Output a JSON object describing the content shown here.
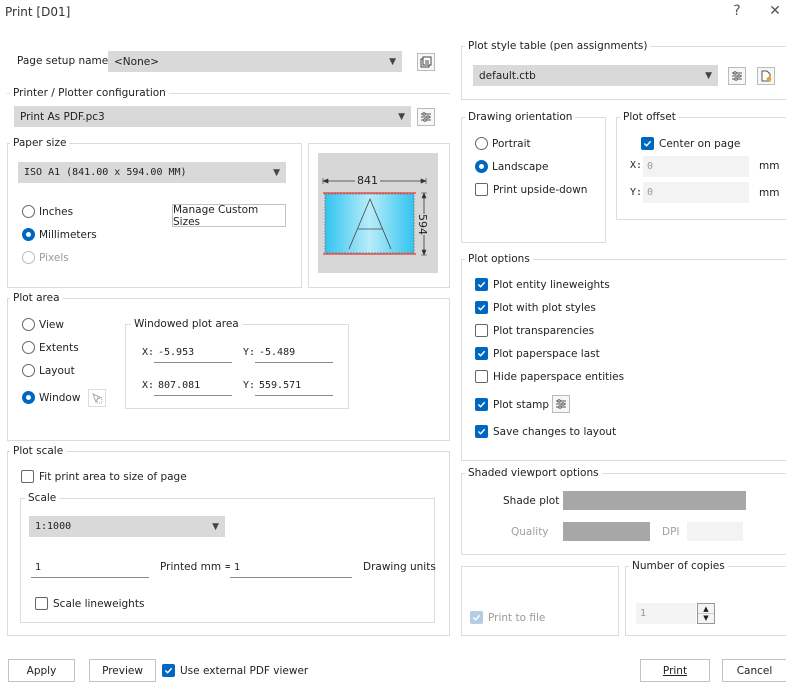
{
  "window": {
    "title": "Print [D01]",
    "help": "?",
    "close": "✕"
  },
  "page_setup": {
    "label": "Page setup name:",
    "value": "<None>"
  },
  "printer": {
    "group": "Printer / Plotter configuration",
    "value": "Print As PDF.pc3"
  },
  "paper_size": {
    "group": "Paper size",
    "value": "ISO A1 (841.00 x 594.00 MM)",
    "units": [
      "Inches",
      "Millimeters",
      "Pixels"
    ],
    "manage_button": "Manage Custom Sizes"
  },
  "preview": {
    "width": "841",
    "height": "594"
  },
  "plot_area": {
    "group": "Plot area",
    "options": [
      "View",
      "Extents",
      "Layout",
      "Window"
    ],
    "window_group": "Windowed plot area",
    "x1_label": "X:",
    "x1": "-5.953",
    "y1_label": "Y:",
    "y1": "-5.489",
    "x2_label": "X:",
    "x2": "807.081",
    "y2_label": "Y:",
    "y2": "559.571"
  },
  "plot_scale": {
    "group": "Plot scale",
    "fit": "Fit print area to size of page",
    "scale_group": "Scale",
    "scale_value": "1:1000",
    "printed_value": "1",
    "printed_label": "Printed mm  =",
    "drawing_value": "1",
    "drawing_label": "Drawing units",
    "lineweights": "Scale lineweights"
  },
  "style_table": {
    "group": "Plot style table (pen assignments)",
    "value": "default.ctb"
  },
  "orientation": {
    "group": "Drawing orientation",
    "portrait": "Portrait",
    "landscape": "Landscape",
    "upside": "Print upside-down"
  },
  "offset": {
    "group": "Plot offset",
    "center": "Center on page",
    "x_label": "X:",
    "x_value": "0",
    "y_label": "Y:",
    "y_value": "0",
    "unit": "mm"
  },
  "plot_options": {
    "group": "Plot options",
    "items": [
      "Plot entity lineweights",
      "Plot with plot styles",
      "Plot transparencies",
      "Plot paperspace last",
      "Hide paperspace entities",
      "Plot stamp",
      "Save changes to layout"
    ]
  },
  "shaded": {
    "group": "Shaded viewport options",
    "shade_label": "Shade plot",
    "quality_label": "Quality",
    "dpi_label": "DPI"
  },
  "print_to_file": "Print to file",
  "copies": {
    "group": "Number of copies",
    "value": "1"
  },
  "footer": {
    "apply": "Apply",
    "preview": "Preview",
    "external": "Use external PDF viewer",
    "print": "Print",
    "cancel": "Cancel"
  },
  "colors": {
    "accent": "#0067c0",
    "combo": "#d9d9d9",
    "paper": "#1ec8f0"
  }
}
